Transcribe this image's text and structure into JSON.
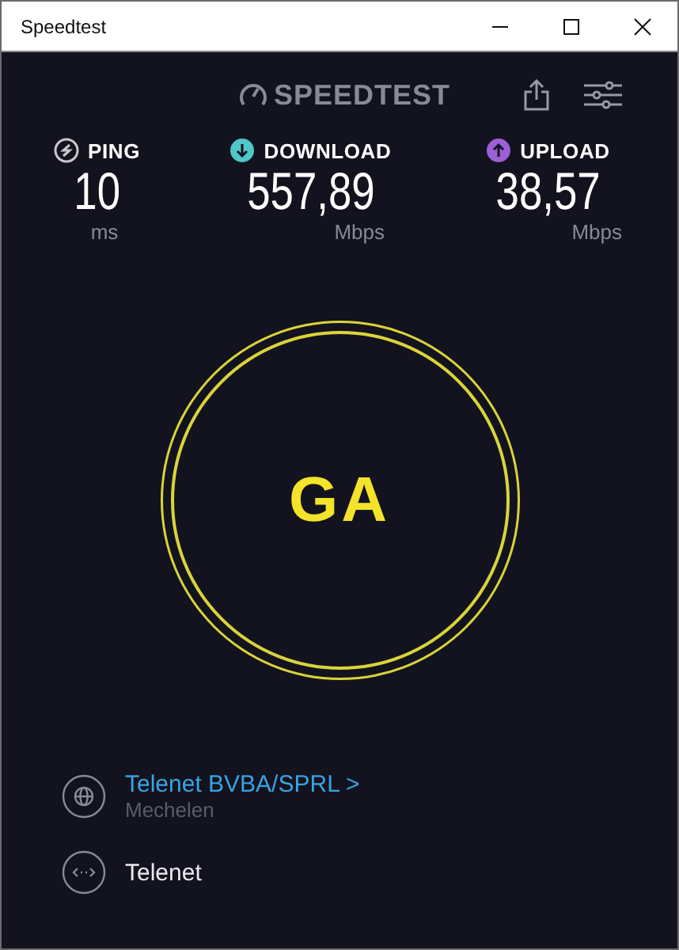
{
  "window": {
    "title": "Speedtest"
  },
  "logo": {
    "text": "SPEEDTEST"
  },
  "metrics": [
    {
      "label": "PING",
      "value": "10",
      "unit": "ms",
      "color": "#c8c8cc",
      "kind": "ping"
    },
    {
      "label": "DOWNLOAD",
      "value": "557,89",
      "unit": "Mbps",
      "color": "#4fc6c8",
      "kind": "download"
    },
    {
      "label": "UPLOAD",
      "value": "38,57",
      "unit": "Mbps",
      "color": "#9b5fd6",
      "kind": "upload"
    }
  ],
  "go_button": {
    "label": "GA"
  },
  "server": {
    "provider": "Telenet BVBA/SPRL >",
    "location": "Mechelen"
  },
  "connection": {
    "name": "Telenet"
  }
}
